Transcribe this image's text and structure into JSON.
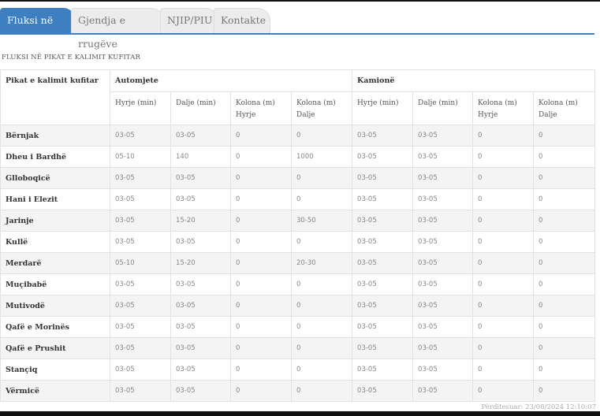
{
  "tabs": [
    {
      "label": "Fluksi në kufi",
      "active": true
    },
    {
      "label": "Gjendja e rrugëve",
      "active": false
    },
    {
      "label": "NJIP/PIU",
      "active": false
    },
    {
      "label": "Kontakte",
      "active": false
    }
  ],
  "section_title": "FLUKSI NË PIKAT E KALIMIT KUFITAR",
  "table": {
    "header_first": "Pikat e kalimit kufitar",
    "group_cars": "Automjete",
    "group_trucks": "Kamionë",
    "sub": [
      "Hyrje (min)",
      "Dalje (min)",
      "Kolona (m) Hyrje",
      "Kolona (m) Dalje",
      "Hyrje (min)",
      "Dalje (min)",
      "Kolona (m) Hyrje",
      "Kolona (m) Dalje"
    ],
    "rows": [
      {
        "name": "Bërnjak",
        "v": [
          "03-05",
          "03-05",
          "0",
          "0",
          "03-05",
          "03-05",
          "0",
          "0"
        ]
      },
      {
        "name": "Dheu i Bardhë",
        "v": [
          "05-10",
          "140",
          "0",
          "1000",
          "03-05",
          "03-05",
          "0",
          "0"
        ]
      },
      {
        "name": "Glloboqicë",
        "v": [
          "03-05",
          "03-05",
          "0",
          "0",
          "03-05",
          "03-05",
          "0",
          "0"
        ]
      },
      {
        "name": "Hani i Elezit",
        "v": [
          "03-05",
          "03-05",
          "0",
          "0",
          "03-05",
          "03-05",
          "0",
          "0"
        ]
      },
      {
        "name": "Jarinje",
        "v": [
          "03-05",
          "15-20",
          "0",
          "30-50",
          "03-05",
          "03-05",
          "0",
          "0"
        ]
      },
      {
        "name": "Kullë",
        "v": [
          "03-05",
          "03-05",
          "0",
          "0",
          "03-05",
          "03-05",
          "0",
          "0"
        ]
      },
      {
        "name": "Merdarë",
        "v": [
          "05-10",
          "15-20",
          "0",
          "20-30",
          "03-05",
          "03-05",
          "0",
          "0"
        ]
      },
      {
        "name": "Muçibabë",
        "v": [
          "03-05",
          "03-05",
          "0",
          "0",
          "03-05",
          "03-05",
          "0",
          "0"
        ]
      },
      {
        "name": "Mutivodë",
        "v": [
          "03-05",
          "03-05",
          "0",
          "0",
          "03-05",
          "03-05",
          "0",
          "0"
        ]
      },
      {
        "name": "Qafë e Morinës",
        "v": [
          "03-05",
          "03-05",
          "0",
          "0",
          "03-05",
          "03-05",
          "0",
          "0"
        ]
      },
      {
        "name": "Qafë e Prushit",
        "v": [
          "03-05",
          "03-05",
          "0",
          "0",
          "03-05",
          "03-05",
          "0",
          "0"
        ]
      },
      {
        "name": "Stançiq",
        "v": [
          "03-05",
          "03-05",
          "0",
          "0",
          "03-05",
          "03-05",
          "0",
          "0"
        ]
      },
      {
        "name": "Vërmicë",
        "v": [
          "03-05",
          "03-05",
          "0",
          "0",
          "03-05",
          "03-05",
          "0",
          "0"
        ]
      }
    ]
  },
  "updated": "Përditesuar: 23/08/2024 12:10:07"
}
